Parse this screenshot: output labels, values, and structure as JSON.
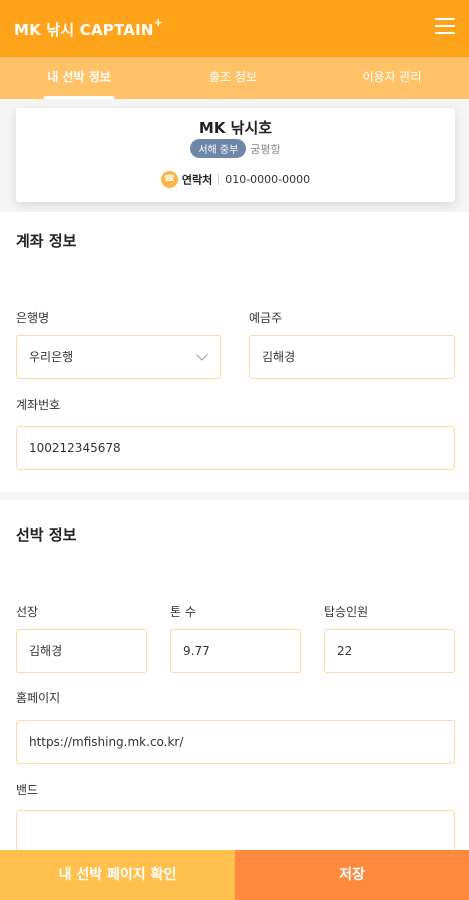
{
  "header": {
    "logo_text": "MK 낚시 CAPTAIN",
    "logo_sup": "+"
  },
  "tabs": [
    {
      "label": "내 선박 정보",
      "active": true
    },
    {
      "label": "출조 정보",
      "active": false
    },
    {
      "label": "이용자 관리",
      "active": false
    }
  ],
  "boat_card": {
    "name": "MK 낚시호",
    "region": "서해 중부",
    "port": "궁평항",
    "contact_label": "연락처",
    "contact_value": "010-0000-0000"
  },
  "account": {
    "title": "계좌 정보",
    "bank_label": "은행명",
    "bank_value": "우리은행",
    "holder_label": "예금주",
    "holder_value": "김해경",
    "number_label": "계좌번호",
    "number_value": "100212345678"
  },
  "vessel": {
    "title": "선박 정보",
    "captain_label": "선장",
    "captain_value": "김해경",
    "tonnage_label": "톤 수",
    "tonnage_value": "9.77",
    "capacity_label": "탑승인원",
    "capacity_value": "22",
    "homepage_label": "홈페이지",
    "homepage_value": "https://mfishing.mk.co.kr/",
    "band_label": "밴드",
    "band_value": ""
  },
  "footer": {
    "view_page_label": "내 선박 페이지 확인",
    "save_label": "저장"
  },
  "colors": {
    "brand": "#ffa31a",
    "tab_bar": "#ffc266",
    "save": "#ff8a3d",
    "view": "#ffc04d"
  }
}
